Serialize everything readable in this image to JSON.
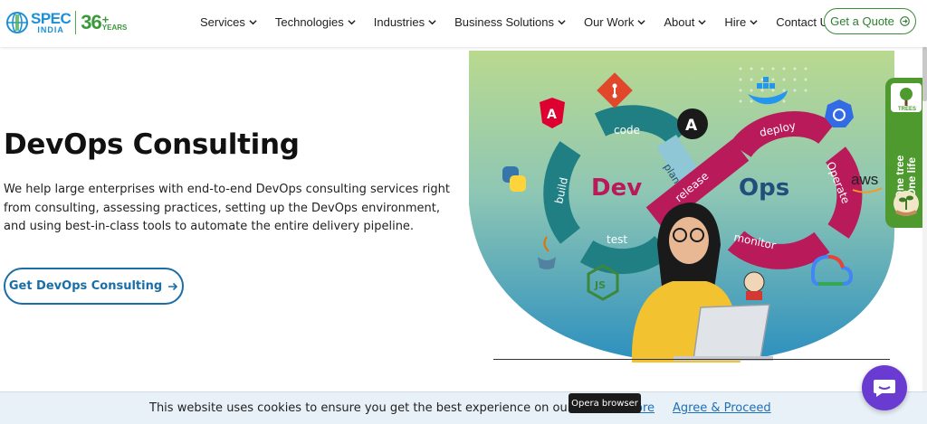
{
  "header": {
    "logo": {
      "brand": "SPEC",
      "country": "INDIA",
      "years_number": "36",
      "years_plus": "+",
      "years_label": "YEARS"
    },
    "nav": [
      {
        "label": "Services",
        "has_dropdown": true
      },
      {
        "label": "Technologies",
        "has_dropdown": true
      },
      {
        "label": "Industries",
        "has_dropdown": true
      },
      {
        "label": "Business Solutions",
        "has_dropdown": true
      },
      {
        "label": "Our Work",
        "has_dropdown": true
      },
      {
        "label": "About",
        "has_dropdown": true
      },
      {
        "label": "Hire",
        "has_dropdown": true
      },
      {
        "label": "Contact Us",
        "has_dropdown": false
      }
    ],
    "quote_button": "Get a Quote"
  },
  "hero": {
    "title": "DevOps Consulting",
    "description": "We help large enterprises with end-to-end DevOps consulting services right from consulting, assessing practices, setting up the DevOps environment, and using best-in-class tools to automate the entire delivery pipeline.",
    "cta": "Get DevOps Consulting"
  },
  "illustration": {
    "dev_label": "Dev",
    "ops_label": "Ops",
    "dev_stages": [
      "code",
      "plan",
      "build",
      "test"
    ],
    "release_label": "release",
    "ops_stages": [
      "deploy",
      "Operate",
      "monitor"
    ],
    "tool_icons": [
      "git-icon",
      "angular-icon",
      "ansible-icon",
      "docker-icon",
      "kubernetes-icon",
      "python-icon",
      "aws-icon",
      "java-icon",
      "nodejs-icon",
      "jenkins-icon",
      "google-cloud-icon"
    ],
    "aws_text": "aws"
  },
  "side_badge": {
    "line1": "One tree",
    "line2": "One life",
    "logo_text": "TREES"
  },
  "cookie_bar": {
    "text": "This website uses cookies to ensure you get the best experience on our web",
    "more": "ore",
    "agree": "Agree & Proceed"
  },
  "tooltip": "Opera browser",
  "colors": {
    "primary_blue": "#1a6ea8",
    "green": "#3a8d3a",
    "teal": "#1f7f83",
    "magenta": "#b81a5a",
    "chat_purple": "#6a3bd1"
  }
}
